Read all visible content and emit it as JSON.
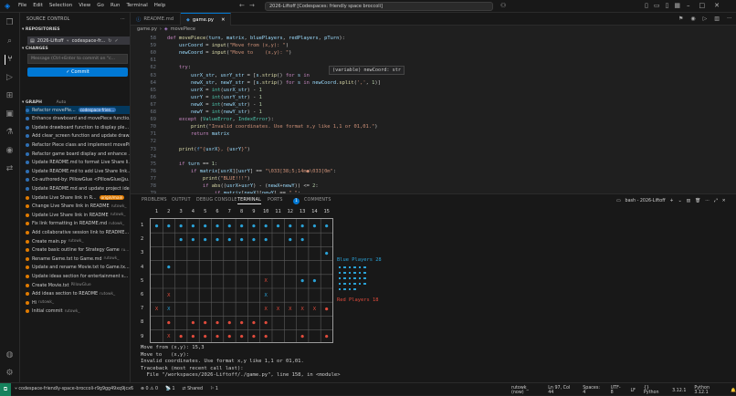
{
  "titlebar": {
    "menu": [
      "File",
      "Edit",
      "Selection",
      "View",
      "Go",
      "Run",
      "Terminal",
      "Help"
    ],
    "search": "2026-Liftoff [Codespaces: friendly space broccoli]"
  },
  "sidebar": {
    "title": "SOURCE CONTROL",
    "repositories_label": "REPOSITORIES",
    "repo_name": "2026-Liftoff",
    "repo_branch": "codespace-fr...",
    "changes_label": "CHANGES",
    "message_placeholder": "Message (Ctrl+Enter to commit on \"c...",
    "commit_label": "✓ Commit",
    "graph_label": "GRAPH",
    "graph_auto": "Auto",
    "graph_items": [
      {
        "text": "Refactor movePle...",
        "tag": "codespace-frien...",
        "color": "#2f6fb3",
        "tagtype": "b"
      },
      {
        "text": "Enhance drawboard and movePiece functio...",
        "color": "#2f6fb3"
      },
      {
        "text": "Update drawboard function to display ple...",
        "color": "#2f6fb3"
      },
      {
        "text": "Add clear_screen function and update draw...",
        "color": "#2f6fb3"
      },
      {
        "text": "Refactor Piece class and implement movePi...",
        "color": "#2f6fb3"
      },
      {
        "text": "Refactor game board display and enhance ...",
        "color": "#2f6fb3"
      },
      {
        "text": "Update README.md to format Live Share li...",
        "color": "#2f6fb3"
      },
      {
        "text": "Update README.md to add Live Share link...",
        "color": "#2f6fb3"
      },
      {
        "text": "Co-authored-by: PillowGlue <PillowGlue@u...",
        "color": "#2f6fb3"
      },
      {
        "text": "Update README.md and update project idea...",
        "color": "#2f6fb3"
      },
      {
        "text": "Update Live Share link in R...",
        "tag": "origin/main",
        "color": "#e07b00",
        "tagtype": "o"
      },
      {
        "text": "Change Live Share link in README",
        "sub": "rutowk_",
        "color": "#e07b00"
      },
      {
        "text": "Update Live Share link in README",
        "sub": "rutowk_",
        "color": "#e07b00"
      },
      {
        "text": "Fix link formatting in README.md",
        "sub": "rutowk_",
        "color": "#e07b00"
      },
      {
        "text": "Add collaborative session link to README...",
        "color": "#e07b00"
      },
      {
        "text": "Create main.py",
        "sub": "rutowk_",
        "color": "#e07b00"
      },
      {
        "text": "Create basic outline for Strategy Game",
        "sub": "ru...",
        "color": "#e07b00"
      },
      {
        "text": "Rename Game.txt to Game.md",
        "sub": "rutowk_",
        "color": "#e07b00"
      },
      {
        "text": "Update and rename Movie.txt to Game.tx...",
        "color": "#e07b00"
      },
      {
        "text": "Update ideas section for entertainment s...",
        "color": "#e07b00"
      },
      {
        "text": "Create Movie.txt",
        "sub": "PillowGlue",
        "color": "#e07b00"
      },
      {
        "text": "Add ideas section to README",
        "sub": "rutowk_",
        "color": "#e07b00"
      },
      {
        "text": "Hi",
        "sub": "rutowk_",
        "color": "#e07b00"
      },
      {
        "text": "Initial commit",
        "sub": "rutowk_",
        "color": "#e07b00"
      }
    ]
  },
  "tabs": [
    {
      "label": "README.md",
      "icon": "ⓘ"
    },
    {
      "label": "game.py",
      "icon": "🐍"
    }
  ],
  "breadcrumb": [
    "game.py",
    "movePiece"
  ],
  "editor": {
    "lines": [
      {
        "n": "58",
        "html": "<span class='kw'>def</span> <span class='fn'>movePiece</span>(<span class='vr'>turn</span>, <span class='vr'>matrix</span>, <span class='vr'>bluePlayers</span>, <span class='vr'>redPlayers</span>, <span class='vr'>pTurn</span>):"
      },
      {
        "n": "59",
        "html": "    <span class='vr'>usrCoord</span> = <span class='fn'>input</span>(<span class='str'>\"Move from (x,y): \"</span>)"
      },
      {
        "n": "60",
        "html": "    <span class='vr'>newCoord</span> = <span class='fn'>input</span>(<span class='str'>\"Move to    (x,y): \"</span>)"
      },
      {
        "n": "61",
        "html": ""
      },
      {
        "n": "62",
        "html": "    <span class='kw'>try</span>:"
      },
      {
        "n": "63",
        "html": "        <span class='vr'>usrX_str</span>, <span class='vr'>usrY_str</span> = [<span class='vr'>s</span>.<span class='fn'>strip</span>() <span class='kw'>for</span> <span class='vr'>s</span> <span class='kw'>in</span>"
      },
      {
        "n": "64",
        "html": "        <span class='vr'>newX_str</span>, <span class='vr'>newY_str</span> = [<span class='vr'>s</span>.<span class='fn'>strip</span>() <span class='kw'>for</span> <span class='vr'>s</span> <span class='kw'>in</span> <span class='vr'>newCoord</span>.<span class='fn'>split</span>(<span class='str'>','</span>, <span class='num'>1</span>)]"
      },
      {
        "n": "65",
        "html": "        <span class='vr'>usrX</span> = <span class='cl'>int</span>(<span class='vr'>usrX_str</span>) - <span class='num'>1</span>"
      },
      {
        "n": "66",
        "html": "        <span class='vr'>usrY</span> = <span class='cl'>int</span>(<span class='vr'>usrY_str</span>) - <span class='num'>1</span>"
      },
      {
        "n": "67",
        "html": "        <span class='vr'>newX</span> = <span class='cl'>int</span>(<span class='vr'>newX_str</span>) - <span class='num'>1</span>"
      },
      {
        "n": "68",
        "html": "        <span class='vr'>newY</span> = <span class='cl'>int</span>(<span class='vr'>newY_str</span>) - <span class='num'>1</span>"
      },
      {
        "n": "69",
        "html": "    <span class='kw'>except</span> (<span class='cl'>ValueError</span>, <span class='cl'>IndexError</span>):"
      },
      {
        "n": "70",
        "html": "        <span class='fn'>print</span>(<span class='str'>\"Invalid coordinates. Use format x,y like 1,1 or 01,01.\"</span>)"
      },
      {
        "n": "71",
        "html": "        <span class='kw'>return</span> <span class='vr'>matrix</span>"
      },
      {
        "n": "72",
        "html": ""
      },
      {
        "n": "73",
        "html": "    <span class='fn'>print</span>(<span class='bl'>f</span><span class='str'>\"{</span><span class='vr'>usrX</span><span class='str'>}, {</span><span class='vr'>usrY</span><span class='str'>}\"</span>)"
      },
      {
        "n": "74",
        "html": ""
      },
      {
        "n": "75",
        "html": "    <span class='kw'>if</span> <span class='vr'>turn</span> == <span class='num'>1</span>:"
      },
      {
        "n": "76",
        "html": "        <span class='kw'>if</span> <span class='vr'>matrix</span>[<span class='vr'>usrX</span>][<span class='vr'>usrY</span>] == <span class='str'>\"\\033[38;5;14m●\\033[0m\"</span>:"
      },
      {
        "n": "77",
        "html": "            <span class='fn'>print</span>(<span class='str'>\"BLUE!!!\"</span>)"
      },
      {
        "n": "78",
        "html": "            <span class='kw'>if</span> <span class='fn'>abs</span>((<span class='vr'>usrX</span>+<span class='vr'>usrY</span>) - (<span class='vr'>newX</span>+<span class='vr'>newY</span>)) &lt;= <span class='num'>2</span>:"
      },
      {
        "n": "79",
        "html": "                <span class='kw'>if</span> <span class='vr'>matrix</span>[<span class='vr'>newX</span>][<span class='vr'>newY</span>] == <span class='str'>\" \"</span>:"
      }
    ],
    "hover": "(variable) newCoord: str"
  },
  "panel": {
    "tabs": [
      "PROBLEMS",
      "OUTPUT",
      "DEBUG CONSOLE",
      "TERMINAL",
      "PORTS",
      "COMMENTS"
    ],
    "ports_badge": "1",
    "shell": "bash - 2026-Liftoff"
  },
  "board": {
    "cols": [
      "1",
      "2",
      "3",
      "4",
      "5",
      "6",
      "7",
      "8",
      "9",
      "10",
      "11",
      "12",
      "13",
      "14",
      "15"
    ],
    "rows": [
      "1",
      "2",
      "3",
      "4",
      "5",
      "6",
      "7",
      "8",
      "9"
    ],
    "cells": [
      [
        [
          "b",
          "●"
        ],
        [
          "b",
          "●"
        ],
        [
          "b",
          "●"
        ],
        [
          "b",
          "●"
        ],
        [
          "b",
          "●"
        ],
        [
          "b",
          "●"
        ],
        [
          "b",
          "●"
        ],
        [
          "b",
          "●"
        ],
        [
          "b",
          "●"
        ],
        [
          "b",
          "●"
        ],
        [
          "b",
          "●"
        ],
        [
          "b",
          "●"
        ],
        [
          "b",
          "●"
        ],
        [
          "b",
          "●"
        ],
        [
          "b",
          "●"
        ]
      ],
      [
        [
          "",
          ""
        ],
        [
          "",
          ""
        ],
        [
          "b",
          "●"
        ],
        [
          "b",
          "●"
        ],
        [
          "b",
          "●"
        ],
        [
          "b",
          "●"
        ],
        [
          "b",
          "●"
        ],
        [
          "b",
          "●"
        ],
        [
          "b",
          "●"
        ],
        [
          "b",
          "●"
        ],
        [
          "",
          ""
        ],
        [
          "b",
          "●"
        ],
        [
          "b",
          "●"
        ],
        [
          "",
          ""
        ],
        [
          "",
          ""
        ]
      ],
      [
        [
          "",
          ""
        ],
        [
          "",
          ""
        ],
        [
          "",
          ""
        ],
        [
          "",
          ""
        ],
        [
          "",
          ""
        ],
        [
          "",
          ""
        ],
        [
          "",
          ""
        ],
        [
          "",
          ""
        ],
        [
          "",
          ""
        ],
        [
          "",
          ""
        ],
        [
          "",
          ""
        ],
        [
          "",
          ""
        ],
        [
          "",
          ""
        ],
        [
          "",
          ""
        ],
        [
          "b",
          "●"
        ]
      ],
      [
        [
          "",
          ""
        ],
        [
          "b",
          "●"
        ],
        [
          "",
          ""
        ],
        [
          "",
          ""
        ],
        [
          "",
          ""
        ],
        [
          "",
          ""
        ],
        [
          "",
          ""
        ],
        [
          "",
          ""
        ],
        [
          "",
          ""
        ],
        [
          "",
          ""
        ],
        [
          "",
          ""
        ],
        [
          "",
          ""
        ],
        [
          "",
          ""
        ],
        [
          "",
          ""
        ],
        [
          "",
          ""
        ]
      ],
      [
        [
          "",
          ""
        ],
        [
          "",
          ""
        ],
        [
          "",
          ""
        ],
        [
          "",
          ""
        ],
        [
          "",
          ""
        ],
        [
          "",
          ""
        ],
        [
          "",
          ""
        ],
        [
          "",
          ""
        ],
        [
          "",
          ""
        ],
        [
          "r",
          "X"
        ],
        [
          "",
          ""
        ],
        [
          "",
          ""
        ],
        [
          "b",
          "●"
        ],
        [
          "b",
          "●"
        ],
        [
          "",
          ""
        ]
      ],
      [
        [
          "",
          ""
        ],
        [
          "r",
          "X"
        ],
        [
          "",
          ""
        ],
        [
          "",
          ""
        ],
        [
          "",
          ""
        ],
        [
          "",
          ""
        ],
        [
          "",
          ""
        ],
        [
          "",
          ""
        ],
        [
          "",
          ""
        ],
        [
          "b",
          "X"
        ],
        [
          "",
          ""
        ],
        [
          "",
          ""
        ],
        [
          "",
          ""
        ],
        [
          "",
          ""
        ],
        [
          "",
          ""
        ]
      ],
      [
        [
          "r",
          "X"
        ],
        [
          "b",
          "X"
        ],
        [
          "",
          ""
        ],
        [
          "",
          ""
        ],
        [
          "",
          ""
        ],
        [
          "",
          ""
        ],
        [
          "",
          ""
        ],
        [
          "",
          ""
        ],
        [
          "",
          ""
        ],
        [
          "r",
          "X"
        ],
        [
          "r",
          "X"
        ],
        [
          "r",
          "X"
        ],
        [
          "r",
          "X"
        ],
        [
          "r",
          "X"
        ],
        [
          "r",
          "●"
        ]
      ],
      [
        [
          "",
          ""
        ],
        [
          "r",
          "●"
        ],
        [
          "",
          ""
        ],
        [
          "r",
          "●"
        ],
        [
          "r",
          "●"
        ],
        [
          "r",
          "●"
        ],
        [
          "r",
          "●"
        ],
        [
          "r",
          "●"
        ],
        [
          "r",
          "●"
        ],
        [
          "r",
          "●"
        ],
        [
          "",
          ""
        ],
        [
          "",
          ""
        ],
        [
          "",
          ""
        ],
        [
          "",
          ""
        ],
        [
          "",
          ""
        ]
      ],
      [
        [
          "",
          ""
        ],
        [
          "r",
          "X"
        ],
        [
          "r",
          "●"
        ],
        [
          "r",
          "●"
        ],
        [
          "r",
          "●"
        ],
        [
          "r",
          "●"
        ],
        [
          "r",
          "●"
        ],
        [
          "r",
          "●"
        ],
        [
          "r",
          "●"
        ],
        [
          "r",
          "●"
        ],
        [
          "",
          ""
        ],
        [
          "",
          ""
        ],
        [
          "r",
          "●"
        ],
        [
          "",
          ""
        ],
        [
          "r",
          "●"
        ]
      ]
    ],
    "blue_legend": "Blue Players 28",
    "red_legend": "Red Players 18"
  },
  "terminal": {
    "lines": [
      "Move from (x,y): 15,3",
      "Move to   (x,y):",
      "Invalid coordinates. Use format x,y like 1,1 or 01,01.",
      "Traceback (most recent call last):",
      "  File \"/workspaces/2026-Liftoff/./game.py\", line 158, in <module>"
    ]
  },
  "statusbar": {
    "branch": "codespace-friendly-space-broccoli-r9g9gg49xq9jcx6",
    "problems": "⊗ 0  ⚠ 0",
    "ports": "1",
    "shared": "Shared",
    "extra": "1",
    "user": "rutowk_ (now)",
    "position": "Ln 97, Col 44",
    "spaces": "Spaces: 4",
    "encoding": "UTF-8",
    "eol": "LF",
    "lang": "{} Python",
    "version": "3.12.1",
    "python": "Python 3.12.1"
  },
  "colors": {
    "accent": "#0078d4",
    "blue": "#2aa1d6",
    "red": "#e04b3c",
    "remote": "#16825d"
  }
}
